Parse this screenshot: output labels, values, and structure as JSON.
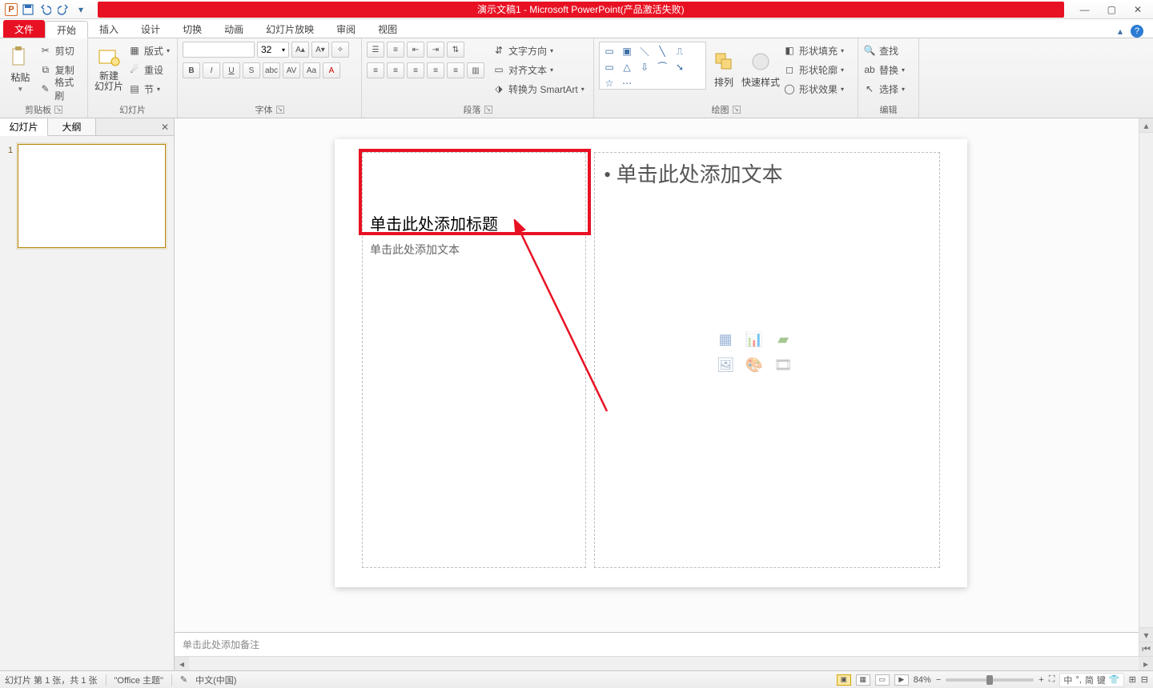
{
  "titlebar": {
    "app_icon_letter": "P",
    "title": "演示文稿1 - Microsoft PowerPoint(产品激活失败)"
  },
  "menu": {
    "file": "文件",
    "tabs": [
      "开始",
      "插入",
      "设计",
      "切换",
      "动画",
      "幻灯片放映",
      "审阅",
      "视图"
    ],
    "active_index": 0
  },
  "ribbon": {
    "clipboard": {
      "paste": "粘贴",
      "cut": "剪切",
      "copy": "复制",
      "format_painter": "格式刷",
      "group": "剪贴板"
    },
    "slides": {
      "new_slide": "新建\n幻灯片",
      "layout": "版式",
      "reset": "重设",
      "section": "节",
      "group": "幻灯片"
    },
    "font": {
      "size": "32",
      "group": "字体",
      "buttons": [
        "B",
        "I",
        "U",
        "S",
        "abc",
        "AV",
        "Aa",
        "A"
      ]
    },
    "paragraph": {
      "text_dir": "文字方向",
      "align_text": "对齐文本",
      "smartart": "转换为 SmartArt",
      "group": "段落"
    },
    "drawing": {
      "arrange": "排列",
      "quick_styles": "快速样式",
      "fill": "形状填充",
      "outline": "形状轮廓",
      "effects": "形状效果",
      "group": "绘图"
    },
    "editing": {
      "find": "查找",
      "replace": "替换",
      "select": "选择",
      "group": "编辑"
    }
  },
  "left_pane": {
    "tabs": {
      "slides": "幻灯片",
      "outline": "大纲"
    },
    "slide_number": "1"
  },
  "slide": {
    "title_placeholder": "单击此处添加标题",
    "subtitle_placeholder": "单击此处添加文本",
    "content_placeholder": "• 单击此处添加文本"
  },
  "notes": {
    "placeholder": "单击此处添加备注"
  },
  "status": {
    "slide_info": "幻灯片 第 1 张，共 1 张",
    "theme": "\"Office 主题\"",
    "language": "中文(中国)",
    "zoom": "84%",
    "ime": {
      "a": "中",
      "b": "简",
      "c": "键"
    }
  }
}
